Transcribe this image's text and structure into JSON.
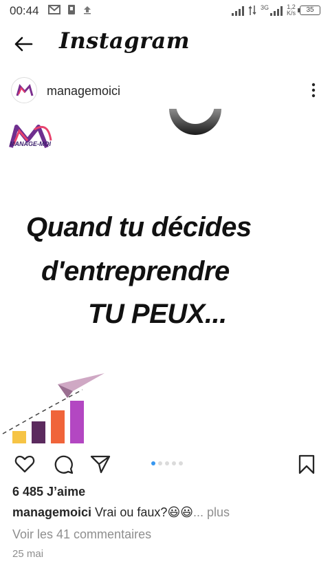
{
  "status_bar": {
    "time": "00:44",
    "network": "3G",
    "speed": "1,2",
    "speed_unit": "K/s",
    "battery": "35"
  },
  "header": {
    "app_title": "Instagram"
  },
  "post": {
    "username": "managemoici",
    "image": {
      "logo_text": "MANAGE-MOI",
      "line1": "Quand tu décides",
      "line2": "d'entreprendre",
      "line3": "TU PEUX...",
      "bar_colors": [
        "#f6c445",
        "#5b2a5e",
        "#f0643a",
        "#b347c2"
      ]
    },
    "carousel": {
      "count": 5,
      "active_index": 0
    },
    "likes": "6 485 J’aime",
    "caption_user": "managemoici",
    "caption_text": " Vrai ou faux?😃😃",
    "caption_more": "... plus",
    "comments_link": "Voir les 41 commentaires",
    "date": "25 mai"
  },
  "colors": {
    "accent": "#3897f0",
    "text": "#262626",
    "muted": "#8e8e8e"
  },
  "icons": {
    "back": "arrow-left-icon",
    "like": "heart-icon",
    "comment": "comment-bubble-icon",
    "share": "paper-plane-icon",
    "save": "bookmark-icon",
    "more": "more-vertical-icon"
  }
}
